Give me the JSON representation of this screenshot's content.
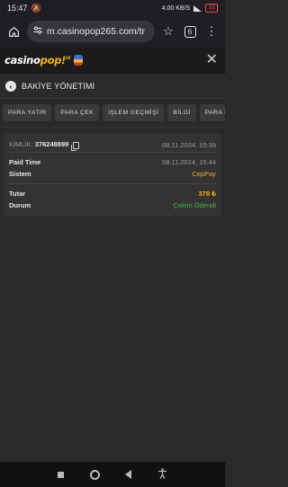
{
  "status": {
    "time": "15:47",
    "net_speed": "4.00 KB/S",
    "battery": "16"
  },
  "browser": {
    "url": "m.casinopop265.com/tr",
    "tab_count": "6"
  },
  "header": {
    "logo_main": "casino",
    "logo_pop": "pop!",
    "logo_badge": "18"
  },
  "page": {
    "title": "BAKİYE YÖNETİMİ"
  },
  "tabs": [
    {
      "label": "PARA YATIR"
    },
    {
      "label": "PARA ÇEK"
    },
    {
      "label": "İŞLEM GEÇMİŞİ"
    },
    {
      "label": "BİLGİ"
    },
    {
      "label": "PARA ÇEKM"
    }
  ],
  "transaction": {
    "id_label": "KİMLİK:",
    "id_value": "376248899",
    "created": "08.11.2024, 15:39",
    "paid_time_label": "Paid Time",
    "paid_time_value": "08.11.2024, 15:44",
    "system_label": "Sistem",
    "system_value": "CepPay",
    "amount_label": "Tutar",
    "amount_value": "378 ₺",
    "status_label": "Durum",
    "status_value": "Çekim Ödendi"
  },
  "colors": {
    "accent": "#f7b500",
    "success": "#3fbf3f",
    "system": "#f0a92c"
  }
}
